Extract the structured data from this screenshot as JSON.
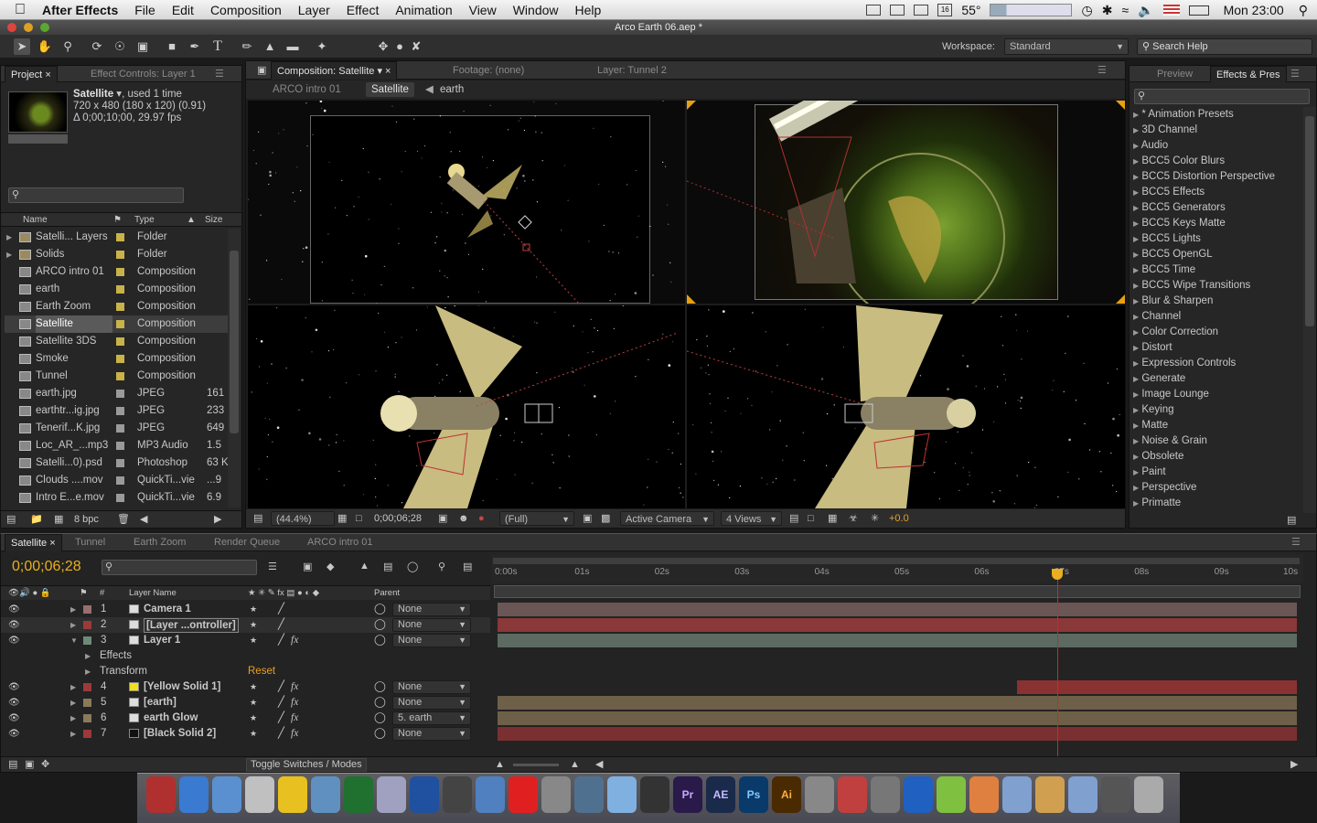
{
  "menubar": {
    "app_name": "After Effects",
    "items": [
      "File",
      "Edit",
      "Composition",
      "Layer",
      "Effect",
      "Animation",
      "View",
      "Window",
      "Help"
    ],
    "temperature": "55°",
    "clock": "Mon 23:00",
    "calendar_day": "16"
  },
  "window": {
    "title": "Arco Earth 06.aep *"
  },
  "toolbar": {
    "workspace_label": "Workspace:",
    "workspace_value": "Standard",
    "search_help_placeholder": "Search Help"
  },
  "project_panel": {
    "tab_project": "Project",
    "tab_effect_controls": "Effect Controls: Layer 1",
    "selected_name": "Satellite",
    "used_text": ", used 1 time",
    "info_line1": "720 x 480  (180 x 120) (0.91)",
    "info_line2": "Δ 0;00;10;00, 29.97 fps",
    "col_name": "Name",
    "col_type": "Type",
    "col_size": "Size",
    "bpc": "8 bpc",
    "items": [
      {
        "name": "Satelli... Layers",
        "type": "Folder",
        "size": "",
        "kind": "folder",
        "color": "#c9b24a"
      },
      {
        "name": "Solids",
        "type": "Folder",
        "size": "",
        "kind": "folder",
        "color": "#c9b24a"
      },
      {
        "name": "ARCO intro 01",
        "type": "Composition",
        "size": "",
        "kind": "comp",
        "color": "#c9b24a"
      },
      {
        "name": "earth",
        "type": "Composition",
        "size": "",
        "kind": "comp",
        "color": "#c9b24a"
      },
      {
        "name": "Earth Zoom",
        "type": "Composition",
        "size": "",
        "kind": "comp",
        "color": "#c9b24a"
      },
      {
        "name": "Satellite",
        "type": "Composition",
        "size": "",
        "kind": "comp",
        "color": "#c9b24a",
        "selected": true
      },
      {
        "name": "Satellite 3DS",
        "type": "Composition",
        "size": "",
        "kind": "comp",
        "color": "#c9b24a"
      },
      {
        "name": "Smoke",
        "type": "Composition",
        "size": "",
        "kind": "comp",
        "color": "#c9b24a"
      },
      {
        "name": "Tunnel",
        "type": "Composition",
        "size": "",
        "kind": "comp",
        "color": "#c9b24a"
      },
      {
        "name": "earth.jpg",
        "type": "JPEG",
        "size": "161",
        "kind": "file",
        "color": "#9a9a9a"
      },
      {
        "name": "earthtr...ig.jpg",
        "type": "JPEG",
        "size": "233",
        "kind": "file",
        "color": "#9a9a9a"
      },
      {
        "name": "Tenerif...K.jpg",
        "type": "JPEG",
        "size": "649",
        "kind": "file",
        "color": "#9a9a9a"
      },
      {
        "name": "Loc_AR_...mp3",
        "type": "MP3 Audio",
        "size": "1.5",
        "kind": "file",
        "color": "#9a9a9a"
      },
      {
        "name": "Satelli...0).psd",
        "type": "Photoshop",
        "size": "63 K",
        "kind": "file",
        "color": "#9a9a9a"
      },
      {
        "name": "Clouds ....mov",
        "type": "QuickTi...vie",
        "size": "...9",
        "kind": "file",
        "color": "#9a9a9a"
      },
      {
        "name": "Intro E...e.mov",
        "type": "QuickTi...vie",
        "size": "6.9",
        "kind": "file",
        "color": "#9a9a9a"
      }
    ]
  },
  "composition_panel": {
    "tab_comp": "Composition: Satellite",
    "tab_footage": "Footage: (none)",
    "tab_layer": "Layer: Tunnel 2",
    "breadcrumbs": [
      "ARCO intro 01",
      "Satellite",
      "earth"
    ],
    "zoom": "(44.4%)",
    "timecode": "0;00;06;28",
    "resolution": "(Full)",
    "camera": "Active Camera",
    "views": "4 Views",
    "exposure": "+0.0"
  },
  "effects_panel": {
    "tab_preview": "Preview",
    "tab_effects": "Effects & Pres",
    "items": [
      "* Animation Presets",
      "3D Channel",
      "Audio",
      "BCC5 Color Blurs",
      "BCC5 Distortion Perspective",
      "BCC5 Effects",
      "BCC5 Generators",
      "BCC5 Keys Matte",
      "BCC5 Lights",
      "BCC5 OpenGL",
      "BCC5 Time",
      "BCC5 Wipe Transitions",
      "Blur & Sharpen",
      "Channel",
      "Color Correction",
      "Distort",
      "Expression Controls",
      "Generate",
      "Image Lounge",
      "Keying",
      "Matte",
      "Noise & Grain",
      "Obsolete",
      "Paint",
      "Perspective",
      "Primatte"
    ]
  },
  "timeline": {
    "tabs": [
      "Satellite",
      "Tunnel",
      "Earth Zoom",
      "Render Queue",
      "ARCO intro 01"
    ],
    "timecode": "0;00;06;28",
    "col_layer_name": "Layer Name",
    "col_parent": "Parent",
    "toggle_label": "Toggle Switches / Modes",
    "ruler": [
      "0:00s",
      "01s",
      "02s",
      "03s",
      "04s",
      "05s",
      "06s",
      "07s",
      "08s",
      "09s",
      "10s"
    ],
    "playhead_seconds": 7.0,
    "layers": [
      {
        "num": "1",
        "name": "Camera 1",
        "label": "#9a6e6e",
        "parent": "None",
        "fx": false,
        "indent": 0,
        "bar": "#6b5656",
        "start": 0,
        "end": 10
      },
      {
        "num": "2",
        "name": "[Layer ...ontroller]",
        "label": "#9a3a3a",
        "parent": "None",
        "fx": false,
        "indent": 0,
        "bar": "#8a3838",
        "start": 0,
        "end": 10,
        "boxed": true
      },
      {
        "num": "3",
        "name": "Layer 1",
        "label": "#6e8a7a",
        "parent": "None",
        "fx": true,
        "indent": 0,
        "bar": "#5c6a62",
        "start": 0,
        "end": 10,
        "open": true
      },
      {
        "num": "",
        "name": "Effects",
        "sub": true
      },
      {
        "num": "",
        "name": "Transform",
        "sub": true,
        "reset": "Reset"
      },
      {
        "num": "4",
        "name": "[Yellow Solid 1]",
        "label": "#9a3a3a",
        "parent": "None",
        "fx": true,
        "bar": "#8a3232",
        "start": 6.5,
        "end": 10
      },
      {
        "num": "5",
        "name": "[earth]",
        "label": "#8a7a5a",
        "parent": "None",
        "fx": true,
        "bar": "#6e6048",
        "start": 0,
        "end": 10
      },
      {
        "num": "6",
        "name": "earth Glow",
        "label": "#8a7a5a",
        "parent": "5. earth",
        "fx": true,
        "bar": "#6e6048",
        "start": 0,
        "end": 10
      },
      {
        "num": "7",
        "name": "[Black Solid 2]",
        "label": "#9a3a3a",
        "parent": "None",
        "fx": true,
        "bar": "#7a3030",
        "start": 0,
        "end": 10
      }
    ]
  },
  "dock": {
    "labels": [
      "Pr",
      "AE",
      "Ps",
      "Ai"
    ]
  },
  "colors": {
    "accent_orange": "#f0a020",
    "timecode_yellow": "#e8b020",
    "playhead_red": "#e02020"
  }
}
